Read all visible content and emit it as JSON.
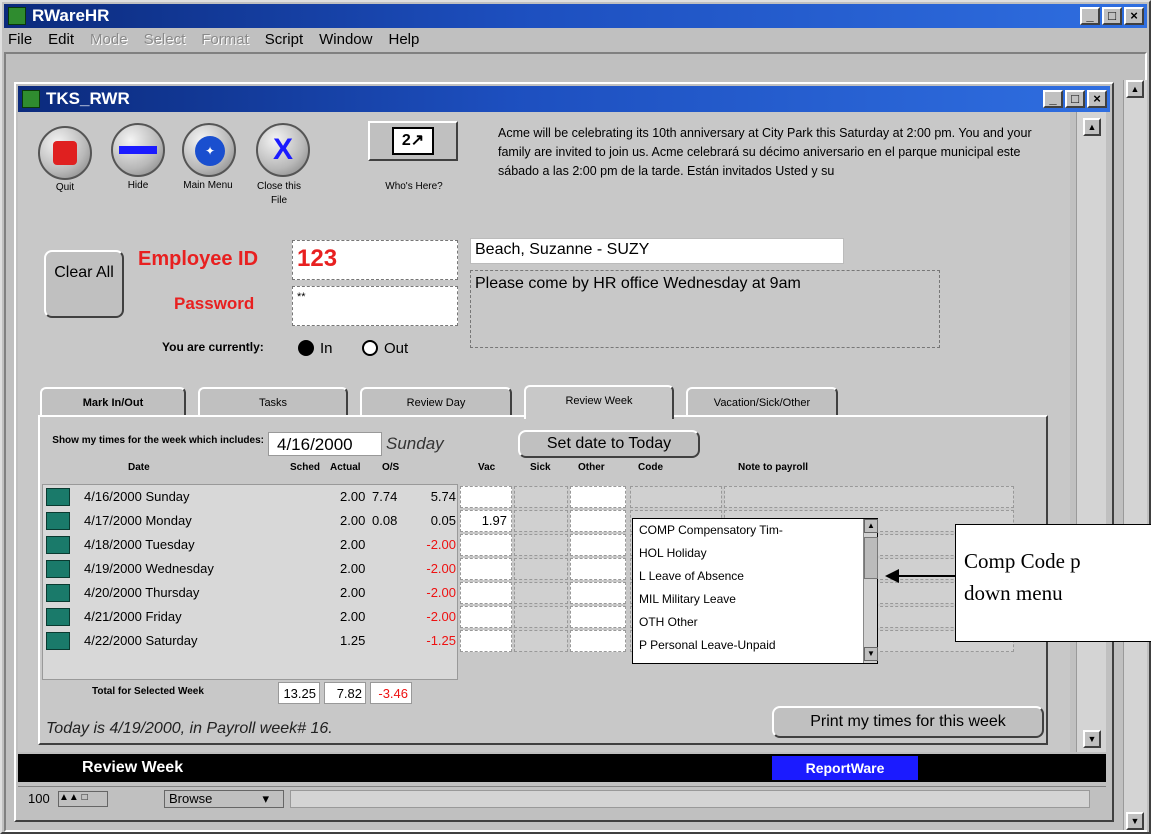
{
  "app": {
    "title": "RWareHR"
  },
  "menu": {
    "file": "File",
    "edit": "Edit",
    "mode": "Mode",
    "select": "Select",
    "format": "Format",
    "script": "Script",
    "window": "Window",
    "help": "Help"
  },
  "window": {
    "title": "TKS_RWR"
  },
  "toolbar": {
    "quit": "Quit",
    "hide": "Hide",
    "main_menu": "Main Menu",
    "close_file": "Close this File",
    "whos_here": "Who's Here?"
  },
  "announcement": "Acme will be celebrating its 10th anniversary at City Park this Saturday at 2:00 pm.  You and your family are invited to join us. Acme celebrará su  décimo aniversario en el parque municipal este sábado a las 2:00 pm de la tarde.  Están invitados Usted y su",
  "login": {
    "clear_label": "Clear All",
    "employee_id_label": "Employee ID",
    "employee_id_value": "123",
    "password_label": "Password",
    "password_value": "**",
    "status_label": "You are currently:",
    "in_label": "In",
    "out_label": "Out"
  },
  "employee": {
    "name": "Beach, Suzanne  - SUZY",
    "message": "Please come by HR office Wednesday at 9am"
  },
  "tabs": [
    "Mark In/Out",
    "Tasks",
    "Review Day",
    "Review Week",
    "Vacation/Sick/Other"
  ],
  "week": {
    "show_label": "Show my times for the week which includes:",
    "date": "4/16/2000",
    "day": "Sunday",
    "set_today": "Set date to Today",
    "headers": {
      "date": "Date",
      "sched": "Sched",
      "actual": "Actual",
      "os": "O/S",
      "vac": "Vac",
      "sick": "Sick",
      "other": "Other",
      "code": "Code",
      "note": "Note to payroll"
    },
    "rows": [
      {
        "date": "4/16/2000 Sunday",
        "sched": "2.00",
        "actual": "7.74",
        "os": "5.74",
        "vac": ""
      },
      {
        "date": "4/17/2000 Monday",
        "sched": "2.00",
        "actual": "0.08",
        "os": "0.05",
        "vac": "1.97"
      },
      {
        "date": "4/18/2000 Tuesday",
        "sched": "2.00",
        "actual": "",
        "os": "-2.00",
        "vac": ""
      },
      {
        "date": "4/19/2000 Wednesday",
        "sched": "2.00",
        "actual": "",
        "os": "-2.00",
        "vac": ""
      },
      {
        "date": "4/20/2000 Thursday",
        "sched": "2.00",
        "actual": "",
        "os": "-2.00",
        "vac": ""
      },
      {
        "date": "4/21/2000 Friday",
        "sched": "2.00",
        "actual": "",
        "os": "-2.00",
        "vac": ""
      },
      {
        "date": "4/22/2000 Saturday",
        "sched": "1.25",
        "actual": "",
        "os": "-1.25",
        "vac": ""
      }
    ],
    "total_label": "Total for Selected Week",
    "total_sched": "13.25",
    "total_actual": "7.82",
    "total_os": "-3.46",
    "today_text": "Today is 4/19/2000, in Payroll week# 16.",
    "print_label": "Print my times for this week"
  },
  "dropdown": {
    "items": [
      "COMP  Compensatory Tim-",
      "HOL  Holiday",
      "L  Leave of Absence",
      "MIL  Military Leave",
      "OTH  Other",
      "P  Personal Leave-Unpaid"
    ]
  },
  "callout": {
    "line1": "Comp Code p",
    "line2": "down menu"
  },
  "footer": {
    "left": "Review Week",
    "right": "ReportWare"
  },
  "status": {
    "zoom": "100",
    "mode": "Browse"
  },
  "colors": {
    "red_label": "#e82020",
    "accent_blue": "#1b1bff",
    "negative": "#e11111"
  }
}
